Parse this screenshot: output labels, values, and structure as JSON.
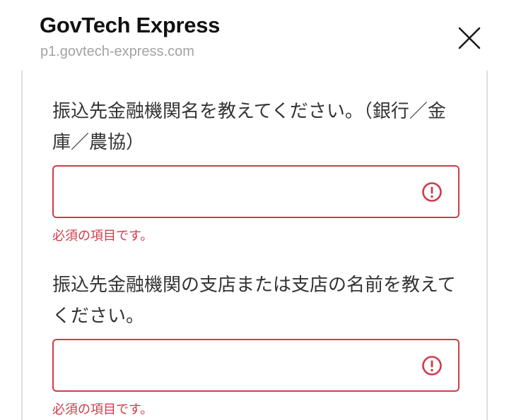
{
  "header": {
    "title": "GovTech Express",
    "url": "p1.govtech-express.com"
  },
  "fields": [
    {
      "question": "振込先金融機関名を教えてください。（銀行／金庫／農協）",
      "value": "",
      "error": "必須の項目です。"
    },
    {
      "question": "振込先金融機関の支店または支店の名前を教えてください。",
      "value": "",
      "error": "必須の項目です。"
    }
  ],
  "colors": {
    "error": "#d23a4a",
    "title": "#111111",
    "url": "#a3a3a3",
    "text": "#333333"
  },
  "icons": {
    "close": "close-icon",
    "alert": "alert-circle-icon"
  }
}
